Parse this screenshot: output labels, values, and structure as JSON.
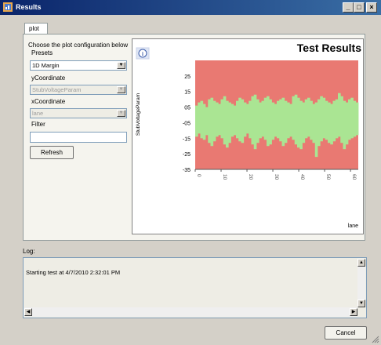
{
  "window": {
    "title": "Results",
    "min_label": "_",
    "max_label": "□",
    "close_label": "×"
  },
  "tabs": [
    {
      "label": "plot"
    }
  ],
  "config": {
    "heading": "Choose the plot configuration below",
    "presets_label": "Presets",
    "presets_value": "1D Margin",
    "ycoord_label": "yCoordinate",
    "ycoord_value": "StubVoltageParam",
    "xcoord_label": "xCoordinate",
    "xcoord_value": "lane",
    "filter_label": "Filter",
    "filter_value": "",
    "refresh_label": "Refresh"
  },
  "chart_data": {
    "type": "heatmap",
    "title": "Test Results",
    "info_icon": "info-icon",
    "xlabel": "lane",
    "ylabel": "StubVoltageParam",
    "xlim": [
      0,
      63
    ],
    "ylim": [
      -35,
      35
    ],
    "x_ticks": [
      "0",
      "10",
      "20",
      "30",
      "40",
      "50",
      "60"
    ],
    "y_ticks": [
      "25",
      "15",
      "05",
      "-05",
      "-15",
      "-25",
      "-35"
    ],
    "colors": {
      "fail": "#e8736c",
      "pass": "#a6e48e"
    },
    "pass_upper": [
      6,
      8,
      9,
      7,
      5,
      10,
      11,
      9,
      8,
      7,
      10,
      12,
      9,
      8,
      7,
      6,
      9,
      11,
      10,
      8,
      7,
      9,
      12,
      13,
      10,
      8,
      9,
      11,
      12,
      10,
      8,
      7,
      9,
      10,
      11,
      9,
      8,
      7,
      12,
      13,
      11,
      9,
      8,
      10,
      11,
      9,
      7,
      8,
      10,
      12,
      11,
      9,
      8,
      7,
      9,
      10,
      14,
      12,
      9,
      8,
      10,
      11,
      9,
      8
    ],
    "pass_lower": [
      -14,
      -12,
      -15,
      -16,
      -13,
      -18,
      -20,
      -17,
      -14,
      -13,
      -15,
      -19,
      -21,
      -18,
      -14,
      -13,
      -15,
      -17,
      -18,
      -14,
      -12,
      -15,
      -19,
      -22,
      -18,
      -15,
      -14,
      -16,
      -20,
      -19,
      -16,
      -14,
      -15,
      -17,
      -20,
      -18,
      -15,
      -14,
      -16,
      -19,
      -21,
      -22,
      -18,
      -15,
      -14,
      -16,
      -18,
      -27,
      -20,
      -17,
      -15,
      -16,
      -18,
      -19,
      -17,
      -15,
      -14,
      -18,
      -22,
      -19,
      -16,
      -15,
      -14,
      -13
    ]
  },
  "log": {
    "label": "Log:",
    "text": "Starting test at 4/7/2010 2:32:01 PM"
  },
  "footer": {
    "cancel_label": "Cancel"
  }
}
